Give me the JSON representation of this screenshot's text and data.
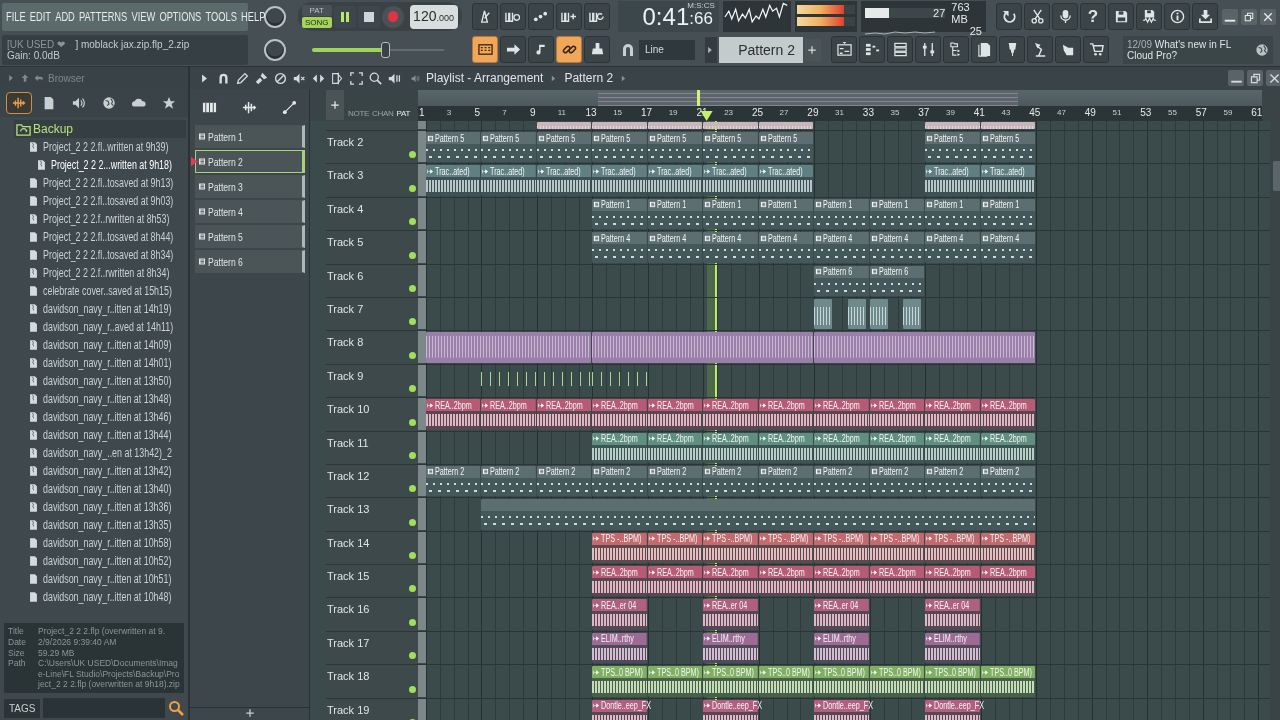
{
  "menu": [
    "FILE",
    "EDIT",
    "ADD",
    "PATTERNS",
    "VIEW",
    "OPTIONS",
    "TOOLS",
    "HELP"
  ],
  "hint": {
    "user": "[UK USED ❤",
    "file": "] moblack jax.zip.flp_2.zip",
    "gain": "Gain:  0.0dB"
  },
  "transport": {
    "modes": [
      {
        "label": "PAT",
        "selected": false
      },
      {
        "label": "SONG",
        "selected": true
      }
    ],
    "playing": true,
    "tempo": "120",
    "tempo_decimals": ".000",
    "master_pitch": {
      "level": 0.55
    }
  },
  "time": {
    "main": "0:41",
    "sub": ":66",
    "unit": "M:S:CS"
  },
  "monitor": {
    "cpu": "27",
    "memory": "763 MB",
    "polyphony": "25",
    "cpu_meter": {
      "level": 0.3
    },
    "peak_meter": {
      "level": 0.8
    }
  },
  "tools_top": [
    {
      "kind": "metronome",
      "on": false
    },
    {
      "kind": "keyboard-clock",
      "on": false
    },
    {
      "kind": "countdown",
      "on": false
    },
    {
      "kind": "keyboard-plus",
      "on": false
    },
    {
      "kind": "keyboard-loop",
      "on": false
    }
  ],
  "help_label": "?",
  "tools_right": [
    {
      "kind": "undo",
      "on": false
    },
    {
      "kind": "scissors",
      "on": false
    },
    {
      "kind": "microphone",
      "on": false
    },
    {
      "kind": "help",
      "on": false
    },
    {
      "kind": "floppy",
      "on": false
    },
    {
      "kind": "floppy-wave",
      "on": false
    },
    {
      "kind": "info",
      "on": false
    },
    {
      "kind": "download",
      "on": false
    }
  ],
  "tools_bottom": [
    {
      "kind": "typing-keyboard",
      "on": true
    },
    {
      "kind": "arrow",
      "on": false
    },
    {
      "kind": "note",
      "on": false
    },
    {
      "kind": "link",
      "on": true
    },
    {
      "kind": "stamp",
      "on": false
    }
  ],
  "snap": "Line",
  "pattern_select": "Pattern 2",
  "windows": [
    {
      "kind": "playlist-window",
      "on": false
    },
    {
      "kind": "step-rows",
      "on": false
    },
    {
      "kind": "channel-list",
      "on": false
    },
    {
      "kind": "mixer-sliders",
      "on": false
    },
    {
      "kind": "folder-tree",
      "on": false
    },
    {
      "kind": "documents",
      "on": false
    },
    {
      "kind": "plug",
      "on": false
    },
    {
      "kind": "desk-lamp",
      "on": false
    },
    {
      "kind": "hand-pointer",
      "on": false
    },
    {
      "kind": "cart",
      "on": false
    }
  ],
  "news": {
    "date": "12/09",
    "text": "What's new in FL Cloud Pro?"
  },
  "browser": {
    "title": "Browser",
    "tabs": [
      {
        "kind": "waveform",
        "selected": true
      },
      {
        "kind": "file",
        "selected": false
      },
      {
        "kind": "speaker",
        "selected": false
      },
      {
        "kind": "globe",
        "selected": false
      },
      {
        "kind": "cloud",
        "selected": false
      },
      {
        "kind": "star",
        "selected": false
      }
    ],
    "folder": "Backup",
    "items": [
      {
        "label": "Project_2 2 2.fl..written at 9h39)",
        "kind": "zip",
        "selected": false
      },
      {
        "label": "Project_2 2 2...written at 9h18)",
        "kind": "zip",
        "selected": true
      },
      {
        "label": "Project_2 2 2.fl..tosaved at 9h13)",
        "kind": "file",
        "selected": false
      },
      {
        "label": "Project_2 2 2.fl..tosaved at 9h03)",
        "kind": "file",
        "selected": false
      },
      {
        "label": "Project_2 2 2.f..rwritten at 8h53)",
        "kind": "zip",
        "selected": false
      },
      {
        "label": "Project_2 2 2.fl..tosaved at 8h44)",
        "kind": "file",
        "selected": false
      },
      {
        "label": "Project_2 2 2.fl..tosaved at 8h34)",
        "kind": "file",
        "selected": false
      },
      {
        "label": "Project_2 2 2.f..rwritten at 8h34)",
        "kind": "zip",
        "selected": false
      },
      {
        "label": "celebrate cover..saved at 15h15)",
        "kind": "file",
        "selected": false
      },
      {
        "label": "davidson_navy_r..itten at 14h19)",
        "kind": "zip",
        "selected": false
      },
      {
        "label": "davidson_navy_r..aved at 14h11)",
        "kind": "file",
        "selected": false
      },
      {
        "label": "davidson_navy_r..itten at 14h09)",
        "kind": "zip",
        "selected": false
      },
      {
        "label": "davidson_navy_r..itten at 14h01)",
        "kind": "zip",
        "selected": false
      },
      {
        "label": "davidson_navy_r..itten at 13h50)",
        "kind": "zip",
        "selected": false
      },
      {
        "label": "davidson_navy_r..itten at 13h48)",
        "kind": "zip",
        "selected": false
      },
      {
        "label": "davidson_navy_r..itten at 13h46)",
        "kind": "zip",
        "selected": false
      },
      {
        "label": "davidson_navy_r..itten at 13h44)",
        "kind": "zip",
        "selected": false
      },
      {
        "label": "davidson_navy_..en at 13h42)_2",
        "kind": "zip",
        "selected": false
      },
      {
        "label": "davidson_navy_r..itten at 13h42)",
        "kind": "zip",
        "selected": false
      },
      {
        "label": "davidson_navy_r..itten at 13h40)",
        "kind": "zip",
        "selected": false
      },
      {
        "label": "davidson_navy_r..itten at 13h36)",
        "kind": "zip",
        "selected": false
      },
      {
        "label": "davidson_navy_r..itten at 13h35)",
        "kind": "zip",
        "selected": false
      },
      {
        "label": "davidson_navy_r..itten at 10h58)",
        "kind": "file",
        "selected": false
      },
      {
        "label": "davidson_navy_r..itten at 10h52)",
        "kind": "file",
        "selected": false
      },
      {
        "label": "davidson_navy_r..itten at 10h51)",
        "kind": "file",
        "selected": false
      },
      {
        "label": "davidson_navy_r..itten at 10h48)",
        "kind": "file",
        "selected": false
      }
    ],
    "info": [
      {
        "key": "Title",
        "value": "Project_2 2 2.flp (overwritten at 9."
      },
      {
        "key": "Date",
        "value": "2/9/2026 9:39:40 AM"
      },
      {
        "key": "Size",
        "value": "59.29 MB"
      },
      {
        "key": "Path",
        "value": "C:\\Users\\UK USED\\Documents\\Image-Line\\FL Studio\\Projects\\Backup\\Project_2 2 2.flp (overwritten at 9h18).zip"
      }
    ],
    "tags_label": "TAGS"
  },
  "patterns": [
    {
      "name": "Pattern 1",
      "selected": false
    },
    {
      "name": "Pattern 2",
      "selected": true
    },
    {
      "name": "Pattern 3",
      "selected": false
    },
    {
      "name": "Pattern 4",
      "selected": false
    },
    {
      "name": "Pattern 5",
      "selected": false
    },
    {
      "name": "Pattern 6",
      "selected": false
    }
  ],
  "playlist": {
    "title": "Playlist - Arrangement",
    "pattern": "Pattern 2",
    "modes": [
      {
        "label": "NOTE",
        "selected": false
      },
      {
        "label": "CHAN",
        "selected": false
      },
      {
        "label": "PAT",
        "selected": true
      }
    ],
    "ruler": [
      "1",
      "3",
      "5",
      "7",
      "9",
      "11",
      "13",
      "15",
      "17",
      "19",
      "21",
      "23",
      "25",
      "27",
      "29",
      "31",
      "33",
      "35",
      "37",
      "39",
      "41",
      "43",
      "45",
      "47",
      "49",
      "51",
      "53",
      "55",
      "57",
      "59",
      "61"
    ],
    "playhead": {
      "level": 0.342
    },
    "tracks": [
      {
        "kind": "audio",
        "color": "#c9b6bb",
        "slots": [
          {
            "kind": "gap"
          },
          {
            "kind": "gap"
          },
          {
            "kind": "clip"
          },
          {
            "kind": "clip"
          },
          {
            "kind": "clip"
          },
          {
            "kind": "clip"
          },
          {
            "kind": "clip"
          },
          {
            "kind": "gap"
          },
          {
            "kind": "gap"
          },
          {
            "kind": "clip"
          },
          {
            "kind": "clip"
          }
        ]
      },
      {
        "name": "Track 2",
        "kind": "pattern",
        "color": "#5d6e71",
        "slots": [
          {
            "kind": "clip",
            "label": "Pattern 5"
          },
          {
            "kind": "clip",
            "label": "Pattern 5"
          },
          {
            "kind": "clip",
            "label": "Pattern 5"
          },
          {
            "kind": "clip",
            "label": "Pattern 5"
          },
          {
            "kind": "clip",
            "label": "Pattern 5"
          },
          {
            "kind": "clip",
            "label": "Pattern 5"
          },
          {
            "kind": "clip",
            "label": "Pattern 5"
          },
          {
            "kind": "gap"
          },
          {
            "kind": "gap"
          },
          {
            "kind": "clip",
            "label": "Pattern 5"
          },
          {
            "kind": "clip",
            "label": "Pattern 5"
          }
        ]
      },
      {
        "name": "Track 3",
        "kind": "audio",
        "color": "#5f7f82",
        "slots": [
          {
            "kind": "clip",
            "label": "Trac..ated)"
          },
          {
            "kind": "clip",
            "label": "Trac..ated)"
          },
          {
            "kind": "clip",
            "label": "Trac..ated)"
          },
          {
            "kind": "clip",
            "label": "Trac..ated)"
          },
          {
            "kind": "clip",
            "label": "Trac..ated)"
          },
          {
            "kind": "clip",
            "label": "Trac..ated)"
          },
          {
            "kind": "clip",
            "label": "Trac..ated)"
          },
          {
            "kind": "gap"
          },
          {
            "kind": "gap"
          },
          {
            "kind": "clip",
            "label": "Trac..ated)"
          },
          {
            "kind": "clip",
            "label": "Trac..ated)"
          }
        ]
      },
      {
        "name": "Track 4",
        "kind": "pattern",
        "color": "#5d6e71",
        "slots": [
          {
            "kind": "gap"
          },
          {
            "kind": "gap"
          },
          {
            "kind": "gap"
          },
          {
            "kind": "clip",
            "label": "Pattern 1"
          },
          {
            "kind": "clip",
            "label": "Pattern 1"
          },
          {
            "kind": "clip",
            "label": "Pattern 1"
          },
          {
            "kind": "clip",
            "label": "Pattern 1"
          },
          {
            "kind": "clip",
            "label": "Pattern 1"
          },
          {
            "kind": "clip",
            "label": "Pattern 1"
          },
          {
            "kind": "clip",
            "label": "Pattern 1"
          },
          {
            "kind": "clip",
            "label": "Pattern 1"
          }
        ]
      },
      {
        "name": "Track 5",
        "kind": "pattern",
        "color": "#5d6e71",
        "slots": [
          {
            "kind": "gap"
          },
          {
            "kind": "gap"
          },
          {
            "kind": "gap"
          },
          {
            "kind": "clip",
            "label": "Pattern 4"
          },
          {
            "kind": "clip",
            "label": "Pattern 4"
          },
          {
            "kind": "clip",
            "label": "Pattern 4"
          },
          {
            "kind": "clip",
            "label": "Pattern 4"
          },
          {
            "kind": "clip",
            "label": "Pattern 4"
          },
          {
            "kind": "clip",
            "label": "Pattern 4"
          },
          {
            "kind": "clip",
            "label": "Pattern 4"
          },
          {
            "kind": "clip",
            "label": "Pattern 4"
          }
        ]
      },
      {
        "name": "Track 6",
        "kind": "pattern",
        "color": "#5d6e71",
        "slots": [
          {
            "kind": "gap"
          },
          {
            "kind": "gap"
          },
          {
            "kind": "gap"
          },
          {
            "kind": "gap"
          },
          {
            "kind": "gap"
          },
          {
            "kind": "gap"
          },
          {
            "kind": "gap"
          },
          {
            "kind": "clip",
            "label": "Pattern 6"
          },
          {
            "kind": "clip",
            "label": "Pattern 6"
          }
        ]
      },
      {
        "name": "Track 7",
        "kind": "shots",
        "color": "#6f8a8c",
        "slots": [
          {
            "kind": "gap"
          },
          {
            "kind": "gap"
          },
          {
            "kind": "gap"
          },
          {
            "kind": "gap"
          },
          {
            "kind": "gap"
          },
          {
            "kind": "gap"
          },
          {
            "kind": "gap"
          },
          {
            "kind": "clip"
          },
          {
            "kind": "clip"
          }
        ]
      },
      {
        "name": "Track 8",
        "kind": "audio",
        "color": "#9a7fab",
        "slots": [
          {
            "kind": "clip"
          },
          {
            "kind": "more"
          },
          {
            "kind": "more"
          },
          {
            "kind": "clip"
          },
          {
            "kind": "more"
          },
          {
            "kind": "more"
          },
          {
            "kind": "more"
          },
          {
            "kind": "clip"
          },
          {
            "kind": "more"
          },
          {
            "kind": "more"
          },
          {
            "kind": "more"
          }
        ]
      },
      {
        "name": "Track 9",
        "kind": "notes",
        "color": "#a6d690",
        "slots": [
          {
            "kind": "gap"
          },
          {
            "kind": "clip"
          },
          {
            "kind": "more"
          },
          {
            "kind": "clip"
          }
        ]
      },
      {
        "name": "Track 10",
        "kind": "audio",
        "color": "#b85a74",
        "slots": [
          {
            "kind": "clip",
            "label": "REA..2bpm"
          },
          {
            "kind": "clip",
            "label": "REA..2bpm"
          },
          {
            "kind": "clip",
            "label": "REA..2bpm"
          },
          {
            "kind": "clip",
            "label": "REA..2bpm"
          },
          {
            "kind": "clip",
            "label": "REA..2bpm"
          },
          {
            "kind": "clip",
            "label": "REA..2bpm"
          },
          {
            "kind": "clip",
            "label": "REA..2bpm"
          },
          {
            "kind": "clip",
            "label": "REA..2bpm"
          },
          {
            "kind": "clip",
            "label": "REA..2bpm"
          },
          {
            "kind": "clip",
            "label": "REA..2bpm"
          },
          {
            "kind": "clip",
            "label": "REA..2bpm"
          }
        ]
      },
      {
        "name": "Track 11",
        "kind": "audio",
        "color": "#5e8f7f",
        "slots": [
          {
            "kind": "gap"
          },
          {
            "kind": "gap"
          },
          {
            "kind": "gap"
          },
          {
            "kind": "clip",
            "label": "REA..2bpm"
          },
          {
            "kind": "clip",
            "label": "REA..2bpm"
          },
          {
            "kind": "clip",
            "label": "REA..2bpm"
          },
          {
            "kind": "clip",
            "label": "REA..2bpm"
          },
          {
            "kind": "clip",
            "label": "REA..2bpm"
          },
          {
            "kind": "clip",
            "label": "REA..2bpm"
          },
          {
            "kind": "clip",
            "label": "REA..2bpm"
          },
          {
            "kind": "clip",
            "label": "REA..2bpm"
          }
        ]
      },
      {
        "name": "Track 12",
        "kind": "pattern",
        "color": "#5d6e71",
        "slots": [
          {
            "kind": "clip",
            "label": "Pattern 2"
          },
          {
            "kind": "clip",
            "label": "Pattern 2"
          },
          {
            "kind": "clip",
            "label": "Pattern 2"
          },
          {
            "kind": "clip",
            "label": "Pattern 2"
          },
          {
            "kind": "clip",
            "label": "Pattern 2"
          },
          {
            "kind": "clip",
            "label": "Pattern 2"
          },
          {
            "kind": "clip",
            "label": "Pattern 2"
          },
          {
            "kind": "clip",
            "label": "Pattern 2"
          },
          {
            "kind": "clip",
            "label": "Pattern 2"
          },
          {
            "kind": "clip",
            "label": "Pattern 2"
          },
          {
            "kind": "clip",
            "label": "Pattern 2"
          }
        ]
      },
      {
        "name": "Track 13",
        "kind": "pattern",
        "color": "#5d6e71",
        "slots": [
          {
            "kind": "gap"
          },
          {
            "kind": "clip"
          },
          {
            "kind": "more"
          },
          {
            "kind": "more"
          },
          {
            "kind": "more"
          },
          {
            "kind": "more"
          },
          {
            "kind": "more"
          },
          {
            "kind": "more"
          },
          {
            "kind": "more"
          },
          {
            "kind": "more"
          },
          {
            "kind": "more"
          }
        ]
      },
      {
        "name": "Track 14",
        "kind": "audio",
        "color": "#c46a6e",
        "slots": [
          {
            "kind": "gap"
          },
          {
            "kind": "gap"
          },
          {
            "kind": "gap"
          },
          {
            "kind": "clip",
            "label": "TPS -..BPM)"
          },
          {
            "kind": "clip",
            "label": "TPS -..BPM)"
          },
          {
            "kind": "clip",
            "label": "TPS -..BPM)"
          },
          {
            "kind": "clip",
            "label": "TPS -..BPM)"
          },
          {
            "kind": "clip",
            "label": "TPS -..BPM)"
          },
          {
            "kind": "clip",
            "label": "TPS -..BPM)"
          },
          {
            "kind": "clip",
            "label": "TPS -..BPM)"
          },
          {
            "kind": "clip",
            "label": "TPS -..BPM)"
          }
        ]
      },
      {
        "name": "Track 15",
        "kind": "audio",
        "color": "#b85a74",
        "slots": [
          {
            "kind": "gap"
          },
          {
            "kind": "gap"
          },
          {
            "kind": "gap"
          },
          {
            "kind": "clip",
            "label": "REA..2bpm"
          },
          {
            "kind": "clip",
            "label": "REA..2bpm"
          },
          {
            "kind": "clip",
            "label": "REA..2bpm"
          },
          {
            "kind": "clip",
            "label": "REA..2bpm"
          },
          {
            "kind": "clip",
            "label": "REA..2bpm"
          },
          {
            "kind": "clip",
            "label": "REA..2bpm"
          },
          {
            "kind": "clip",
            "label": "REA..2bpm"
          },
          {
            "kind": "clip",
            "label": "REA..2bpm"
          }
        ]
      },
      {
        "name": "Track 16",
        "kind": "audio",
        "color": "#b0607e",
        "slots": [
          {
            "kind": "gap"
          },
          {
            "kind": "gap"
          },
          {
            "kind": "gap"
          },
          {
            "kind": "clip",
            "label": "REA..er 04"
          },
          {
            "kind": "gap"
          },
          {
            "kind": "clip",
            "label": "REA..er 04"
          },
          {
            "kind": "gap"
          },
          {
            "kind": "clip",
            "label": "REA..er 04"
          },
          {
            "kind": "gap"
          },
          {
            "kind": "clip",
            "label": "REA..er 04"
          }
        ]
      },
      {
        "name": "Track 17",
        "kind": "audio",
        "color": "#9c6a95",
        "slots": [
          {
            "kind": "gap"
          },
          {
            "kind": "gap"
          },
          {
            "kind": "gap"
          },
          {
            "kind": "clip",
            "label": "ELIM..rthy"
          },
          {
            "kind": "gap"
          },
          {
            "kind": "clip",
            "label": "ELIM..rthy"
          },
          {
            "kind": "gap"
          },
          {
            "kind": "clip",
            "label": "ELIM..rthy"
          },
          {
            "kind": "gap"
          },
          {
            "kind": "clip",
            "label": "ELIM..rthy"
          }
        ]
      },
      {
        "name": "Track 18",
        "kind": "audio",
        "color": "#7fb061",
        "slots": [
          {
            "kind": "gap"
          },
          {
            "kind": "gap"
          },
          {
            "kind": "gap"
          },
          {
            "kind": "clip",
            "label": "TPS..0 BPM)"
          },
          {
            "kind": "clip",
            "label": "TPS..0 BPM)"
          },
          {
            "kind": "clip",
            "label": "TPS..0 BPM)"
          },
          {
            "kind": "clip",
            "label": "TPS..0 BPM)"
          },
          {
            "kind": "clip",
            "label": "TPS..0 BPM)"
          },
          {
            "kind": "clip",
            "label": "TPS..0 BPM)"
          },
          {
            "kind": "clip",
            "label": "TPS..0 BPM)"
          },
          {
            "kind": "clip",
            "label": "TPS..0 BPM)"
          }
        ]
      },
      {
        "name": "Track 19",
        "kind": "audio",
        "color": "#b0607e",
        "slots": [
          {
            "kind": "gap"
          },
          {
            "kind": "gap"
          },
          {
            "kind": "gap"
          },
          {
            "kind": "clip",
            "label": "Dontle..eep_FX"
          },
          {
            "kind": "gap"
          },
          {
            "kind": "clip",
            "label": "Dontle..eep_FX"
          },
          {
            "kind": "gap"
          },
          {
            "kind": "clip",
            "label": "Dontle..eep_FX"
          },
          {
            "kind": "gap"
          },
          {
            "kind": "clip",
            "label": "Dontle..eep_FX"
          }
        ]
      }
    ]
  }
}
